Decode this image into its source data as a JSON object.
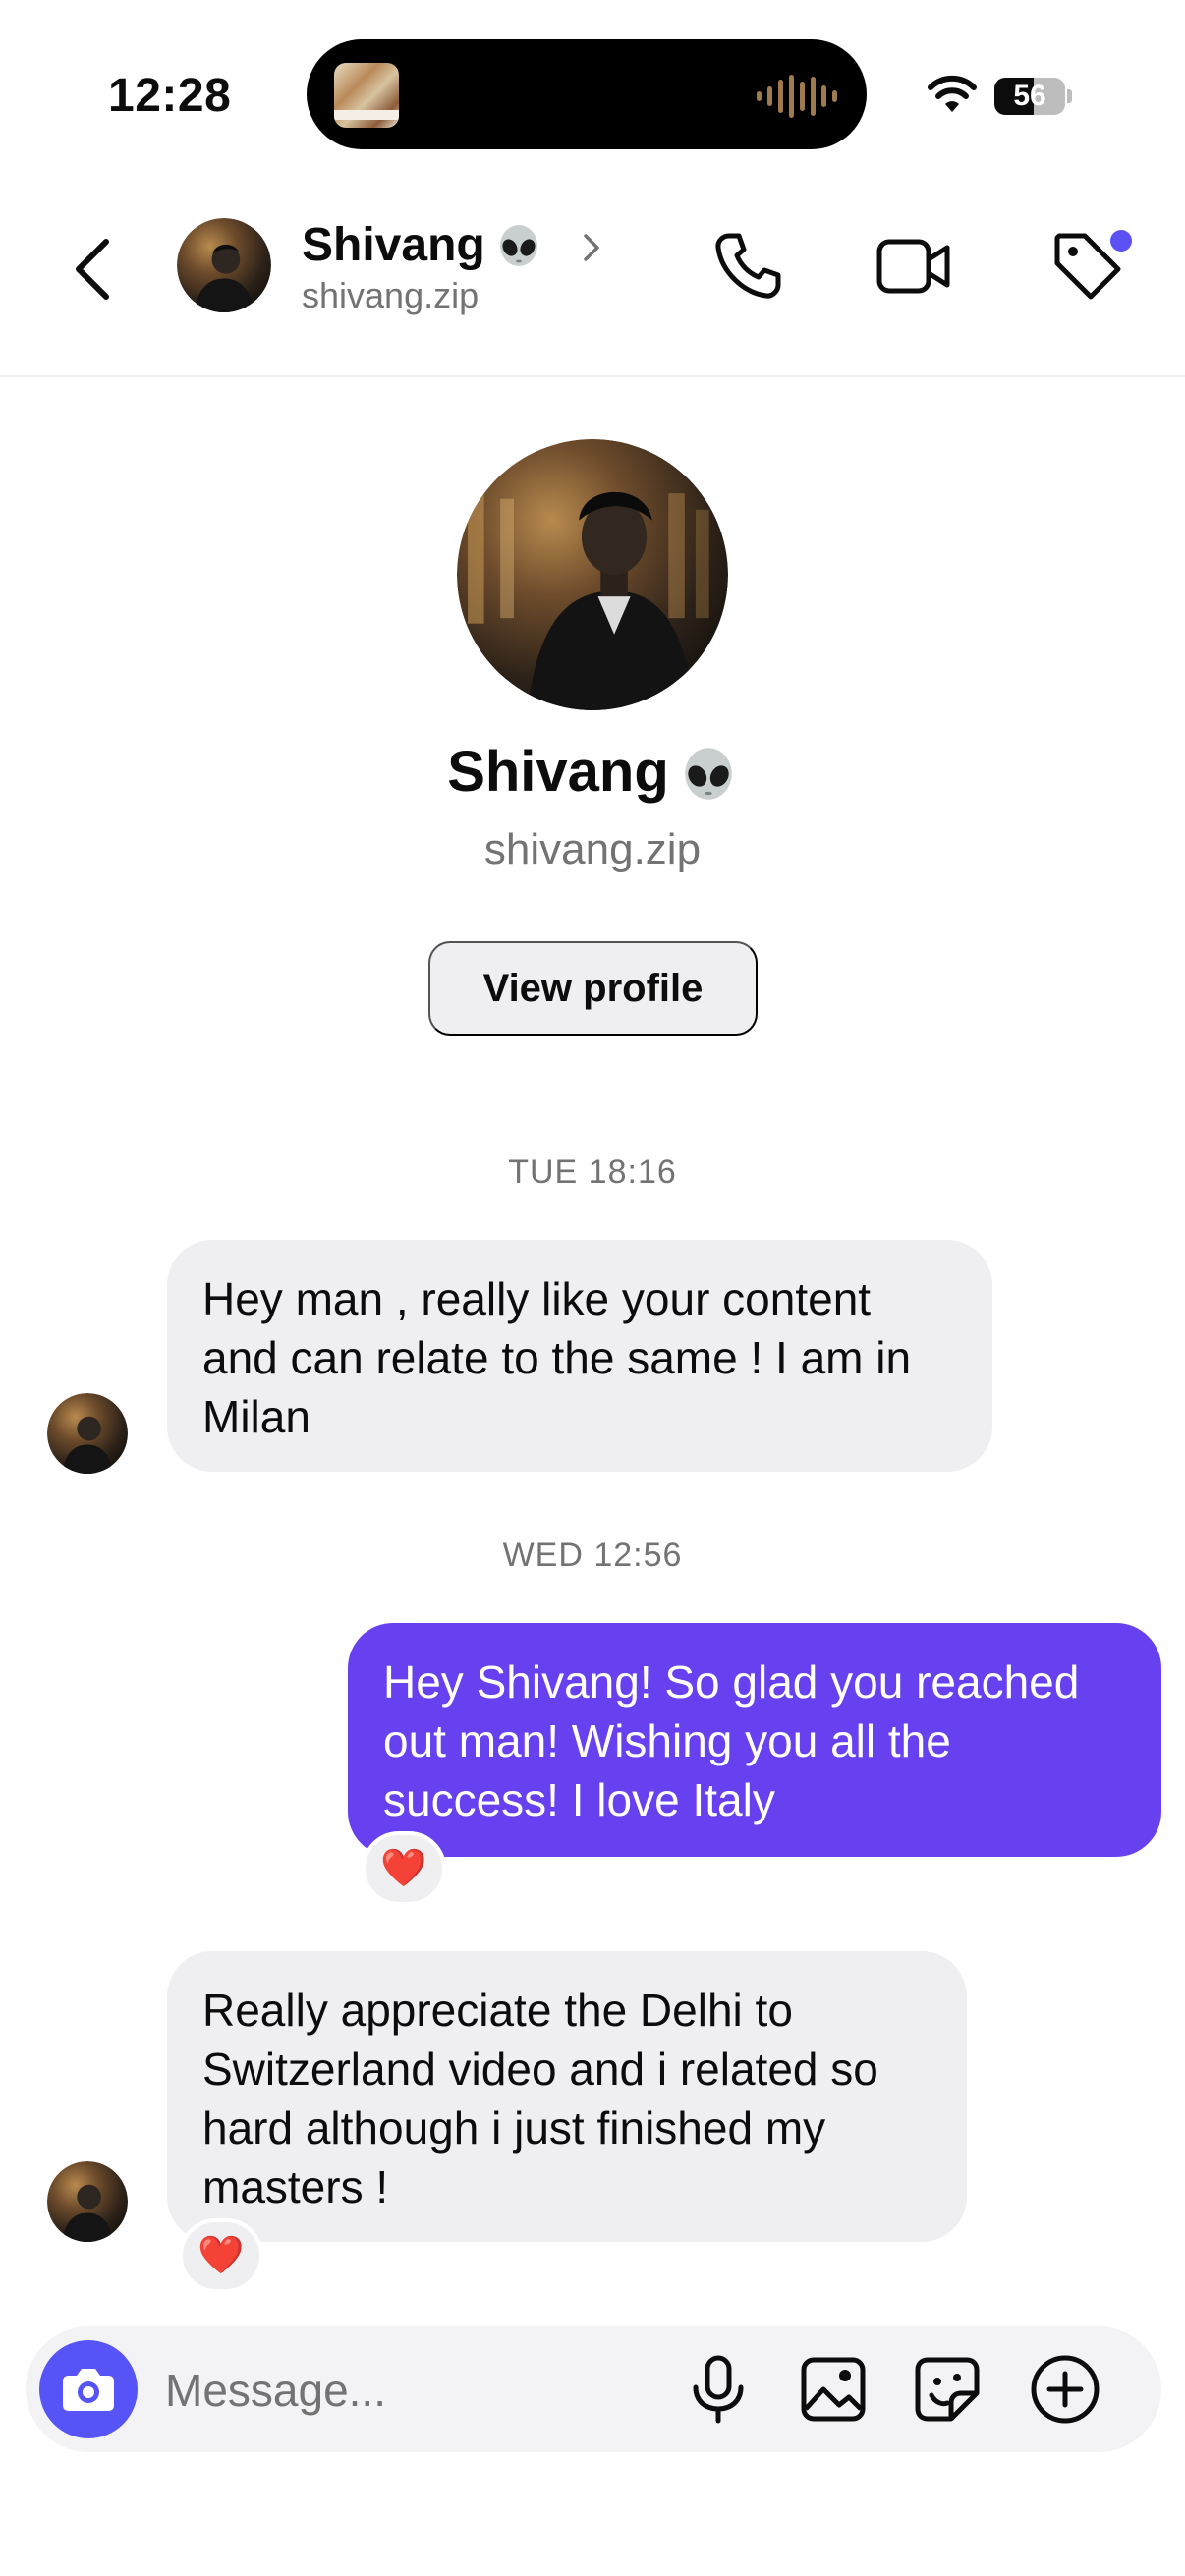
{
  "status_bar": {
    "time": "12:28",
    "battery": "56",
    "battery_level": 0.56
  },
  "header": {
    "name": "Shivang",
    "name_emoji": "alien-icon",
    "username": "shivang.zip",
    "icons": [
      "back-arrow-icon",
      "chevron-right-icon",
      "phone-icon",
      "video-camera-icon",
      "tag-icon"
    ],
    "notification_dot_color": "#5b51f5"
  },
  "profile": {
    "name": "Shivang",
    "username": "shivang.zip",
    "view_profile_label": "View profile"
  },
  "conversation": {
    "sections": [
      {
        "timestamp": "TUE 18:16",
        "messages": [
          {
            "direction": "incoming",
            "text": "Hey man , really like your content and can relate to the same ! I am in Milan"
          }
        ]
      },
      {
        "timestamp": "WED 12:56",
        "messages": [
          {
            "direction": "outgoing",
            "text": "Hey Shivang! So glad you reached out man! Wishing you all the success! I love Italy",
            "reaction": "❤️"
          },
          {
            "direction": "incoming",
            "text": "Really appreciate the Delhi to Switzerland video and i related so hard although i just finished my masters !",
            "reaction": "❤️"
          }
        ]
      }
    ]
  },
  "composer": {
    "placeholder": "Message...",
    "icons": [
      "camera-icon",
      "microphone-icon",
      "gallery-icon",
      "sticker-icon",
      "plus-circle-icon"
    ]
  },
  "colors": {
    "outgoing_bubble": "#6741f0",
    "incoming_bubble": "#efeff2",
    "camera_button": "#5754f7",
    "secondary_text": "#737373"
  }
}
